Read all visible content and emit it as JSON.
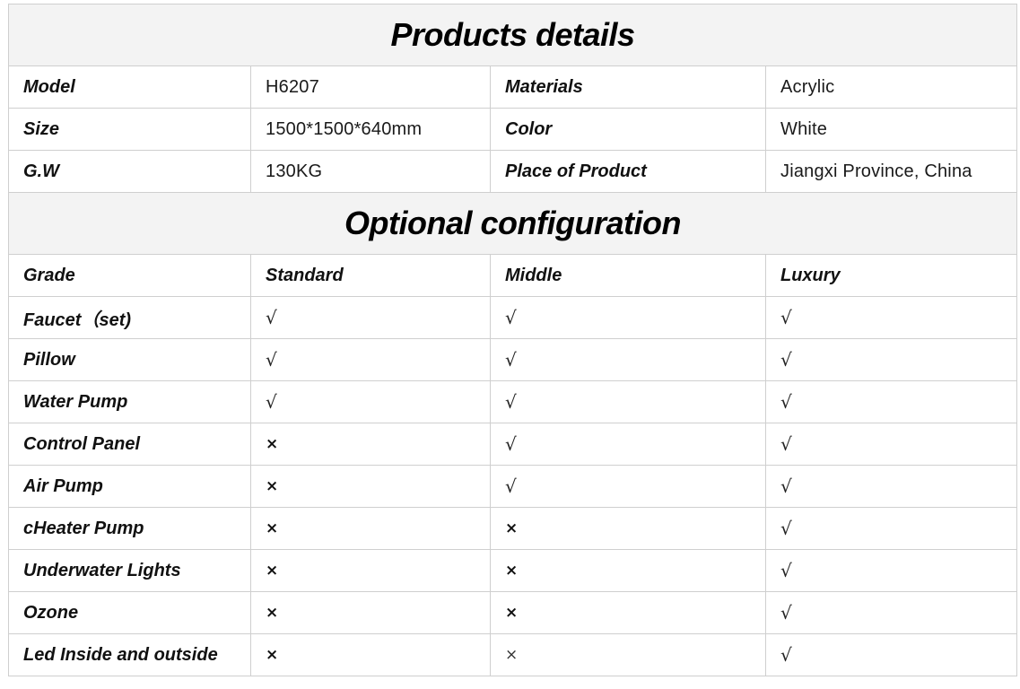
{
  "details": {
    "title": "Products details",
    "rows": [
      {
        "label1": "Model",
        "value1": "H6207",
        "label2": "Materials",
        "value2": "Acrylic"
      },
      {
        "label1": "Size",
        "value1": "1500*1500*640mm",
        "label2": "Color",
        "value2": "White"
      },
      {
        "label1": "G.W",
        "value1": "130KG",
        "label2": "Place of Product",
        "value2": "Jiangxi Province, China"
      }
    ]
  },
  "config": {
    "title": "Optional configuration",
    "headers": [
      "Grade",
      "Standard",
      "Middle",
      "Luxury"
    ],
    "rows": [
      {
        "item": "Faucet（set)",
        "standard": "√",
        "middle": "√",
        "luxury": "√"
      },
      {
        "item": "Pillow",
        "standard": "√",
        "middle": "√",
        "luxury": "√"
      },
      {
        "item": "Water Pump",
        "standard": "√",
        "middle": "√",
        "luxury": "√"
      },
      {
        "item": "Control Panel",
        "standard": "×",
        "middle": "√",
        "luxury": "√"
      },
      {
        "item": "Air Pump",
        "standard": "×",
        "middle": "√",
        "luxury": "√"
      },
      {
        "item": "cHeater Pump",
        "standard": "×",
        "middle": "×",
        "luxury": "√"
      },
      {
        "item": "Underwater Lights",
        "standard": "×",
        "middle": "×",
        "luxury": "√"
      },
      {
        "item": "Ozone",
        "standard": "×",
        "middle": "×",
        "luxury": "√"
      },
      {
        "item": "Led Inside and outside",
        "standard": "×",
        "middle": "×",
        "luxury": "√"
      }
    ]
  },
  "colors": {
    "header_background": "#f3f3f3",
    "border": "#cfcfcf",
    "text": "#111111"
  }
}
